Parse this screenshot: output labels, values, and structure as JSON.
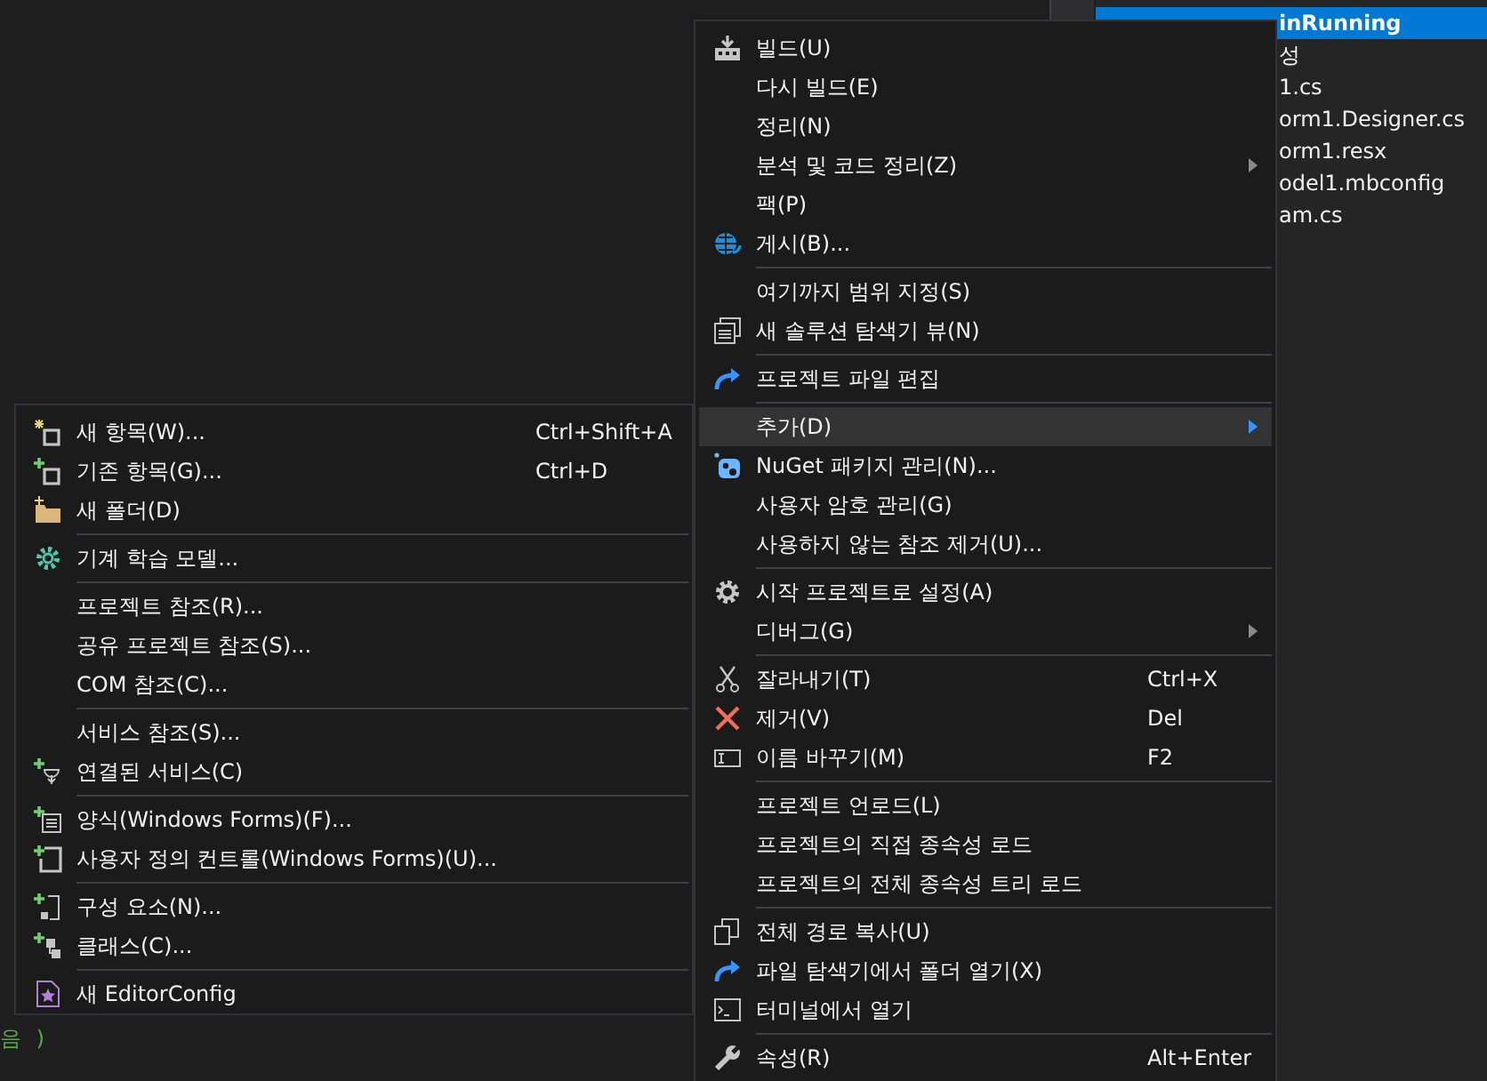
{
  "editor": {
    "code_fragments": [
      {
        "text": "음 )",
        "kind": "string"
      }
    ]
  },
  "solution_explorer": {
    "project": {
      "label": "inRunning",
      "selected": true
    },
    "rows": [
      {
        "label": "성"
      },
      {
        "label": "1.cs"
      },
      {
        "label": "orm1.Designer.cs"
      },
      {
        "label": "orm1.resx"
      },
      {
        "label": "odel1.mbconfig"
      },
      {
        "label": "am.cs"
      }
    ]
  },
  "context_menu": {
    "items": [
      {
        "kind": "item",
        "label": "빌드(U)",
        "selected": false,
        "has_submenu": false
      },
      {
        "kind": "item",
        "label": "다시 빌드(E)",
        "selected": false,
        "has_submenu": false
      },
      {
        "kind": "item",
        "label": "정리(N)",
        "selected": false,
        "has_submenu": false
      },
      {
        "kind": "item",
        "label": "분석 및 코드 정리(Z)",
        "selected": false,
        "has_submenu": true
      },
      {
        "kind": "item",
        "label": "팩(P)",
        "selected": false,
        "has_submenu": false
      },
      {
        "kind": "item",
        "label": "게시(B)...",
        "selected": false,
        "has_submenu": false
      },
      {
        "kind": "separator"
      },
      {
        "kind": "item",
        "label": "여기까지 범위 지정(S)",
        "selected": false,
        "has_submenu": false
      },
      {
        "kind": "item",
        "label": "새 솔루션 탐색기 뷰(N)",
        "selected": false,
        "has_submenu": false
      },
      {
        "kind": "separator"
      },
      {
        "kind": "item",
        "label": "프로젝트 파일 편집",
        "selected": false,
        "has_submenu": false
      },
      {
        "kind": "separator"
      },
      {
        "kind": "item",
        "label": "추가(D)",
        "selected": true,
        "has_submenu": true
      },
      {
        "kind": "item",
        "label": "NuGet 패키지 관리(N)...",
        "selected": false,
        "has_submenu": false
      },
      {
        "kind": "item",
        "label": "사용자 암호 관리(G)",
        "selected": false,
        "has_submenu": false
      },
      {
        "kind": "item",
        "label": "사용하지 않는 참조 제거(U)...",
        "selected": false,
        "has_submenu": false
      },
      {
        "kind": "separator"
      },
      {
        "kind": "item",
        "label": "시작 프로젝트로 설정(A)",
        "selected": false,
        "has_submenu": false
      },
      {
        "kind": "item",
        "label": "디버그(G)",
        "selected": false,
        "has_submenu": true
      },
      {
        "kind": "separator"
      },
      {
        "kind": "item",
        "label": "잘라내기(T)",
        "shortcut": "Ctrl+X",
        "selected": false,
        "has_submenu": false
      },
      {
        "kind": "item",
        "label": "제거(V)",
        "shortcut": "Del",
        "selected": false,
        "has_submenu": false
      },
      {
        "kind": "item",
        "label": "이름 바꾸기(M)",
        "shortcut": "F2",
        "selected": false,
        "has_submenu": false
      },
      {
        "kind": "separator"
      },
      {
        "kind": "item",
        "label": "프로젝트 언로드(L)",
        "selected": false,
        "has_submenu": false
      },
      {
        "kind": "item",
        "label": "프로젝트의 직접 종속성 로드",
        "selected": false,
        "has_submenu": false
      },
      {
        "kind": "item",
        "label": "프로젝트의 전체 종속성 트리 로드",
        "selected": false,
        "has_submenu": false
      },
      {
        "kind": "separator"
      },
      {
        "kind": "item",
        "label": "전체 경로 복사(U)",
        "selected": false,
        "has_submenu": false
      },
      {
        "kind": "item",
        "label": "파일 탐색기에서 폴더 열기(X)",
        "selected": false,
        "has_submenu": false
      },
      {
        "kind": "item",
        "label": "터미널에서 열기",
        "selected": false,
        "has_submenu": false
      },
      {
        "kind": "separator"
      },
      {
        "kind": "item",
        "label": "속성(R)",
        "shortcut": "Alt+Enter",
        "selected": false,
        "has_submenu": false
      }
    ]
  },
  "add_submenu": {
    "items": [
      {
        "kind": "item",
        "label": "새 항목(W)...",
        "shortcut": "Ctrl+Shift+A"
      },
      {
        "kind": "item",
        "label": "기존 항목(G)...",
        "shortcut": "Ctrl+D"
      },
      {
        "kind": "item",
        "label": "새 폴더(D)"
      },
      {
        "kind": "separator"
      },
      {
        "kind": "item",
        "label": "기계 학습 모델..."
      },
      {
        "kind": "separator"
      },
      {
        "kind": "item",
        "label": "프로젝트 참조(R)..."
      },
      {
        "kind": "item",
        "label": "공유 프로젝트 참조(S)..."
      },
      {
        "kind": "item",
        "label": "COM 참조(C)..."
      },
      {
        "kind": "separator"
      },
      {
        "kind": "item",
        "label": "서비스 참조(S)..."
      },
      {
        "kind": "item",
        "label": "연결된 서비스(C)"
      },
      {
        "kind": "separator"
      },
      {
        "kind": "item",
        "label": "양식(Windows Forms)(F)..."
      },
      {
        "kind": "item",
        "label": "사용자 정의 컨트롤(Windows Forms)(U)..."
      },
      {
        "kind": "separator"
      },
      {
        "kind": "item",
        "label": "구성 요소(N)..."
      },
      {
        "kind": "item",
        "label": "클래스(C)..."
      },
      {
        "kind": "separator"
      },
      {
        "kind": "item",
        "label": "새 EditorConfig"
      }
    ]
  }
}
